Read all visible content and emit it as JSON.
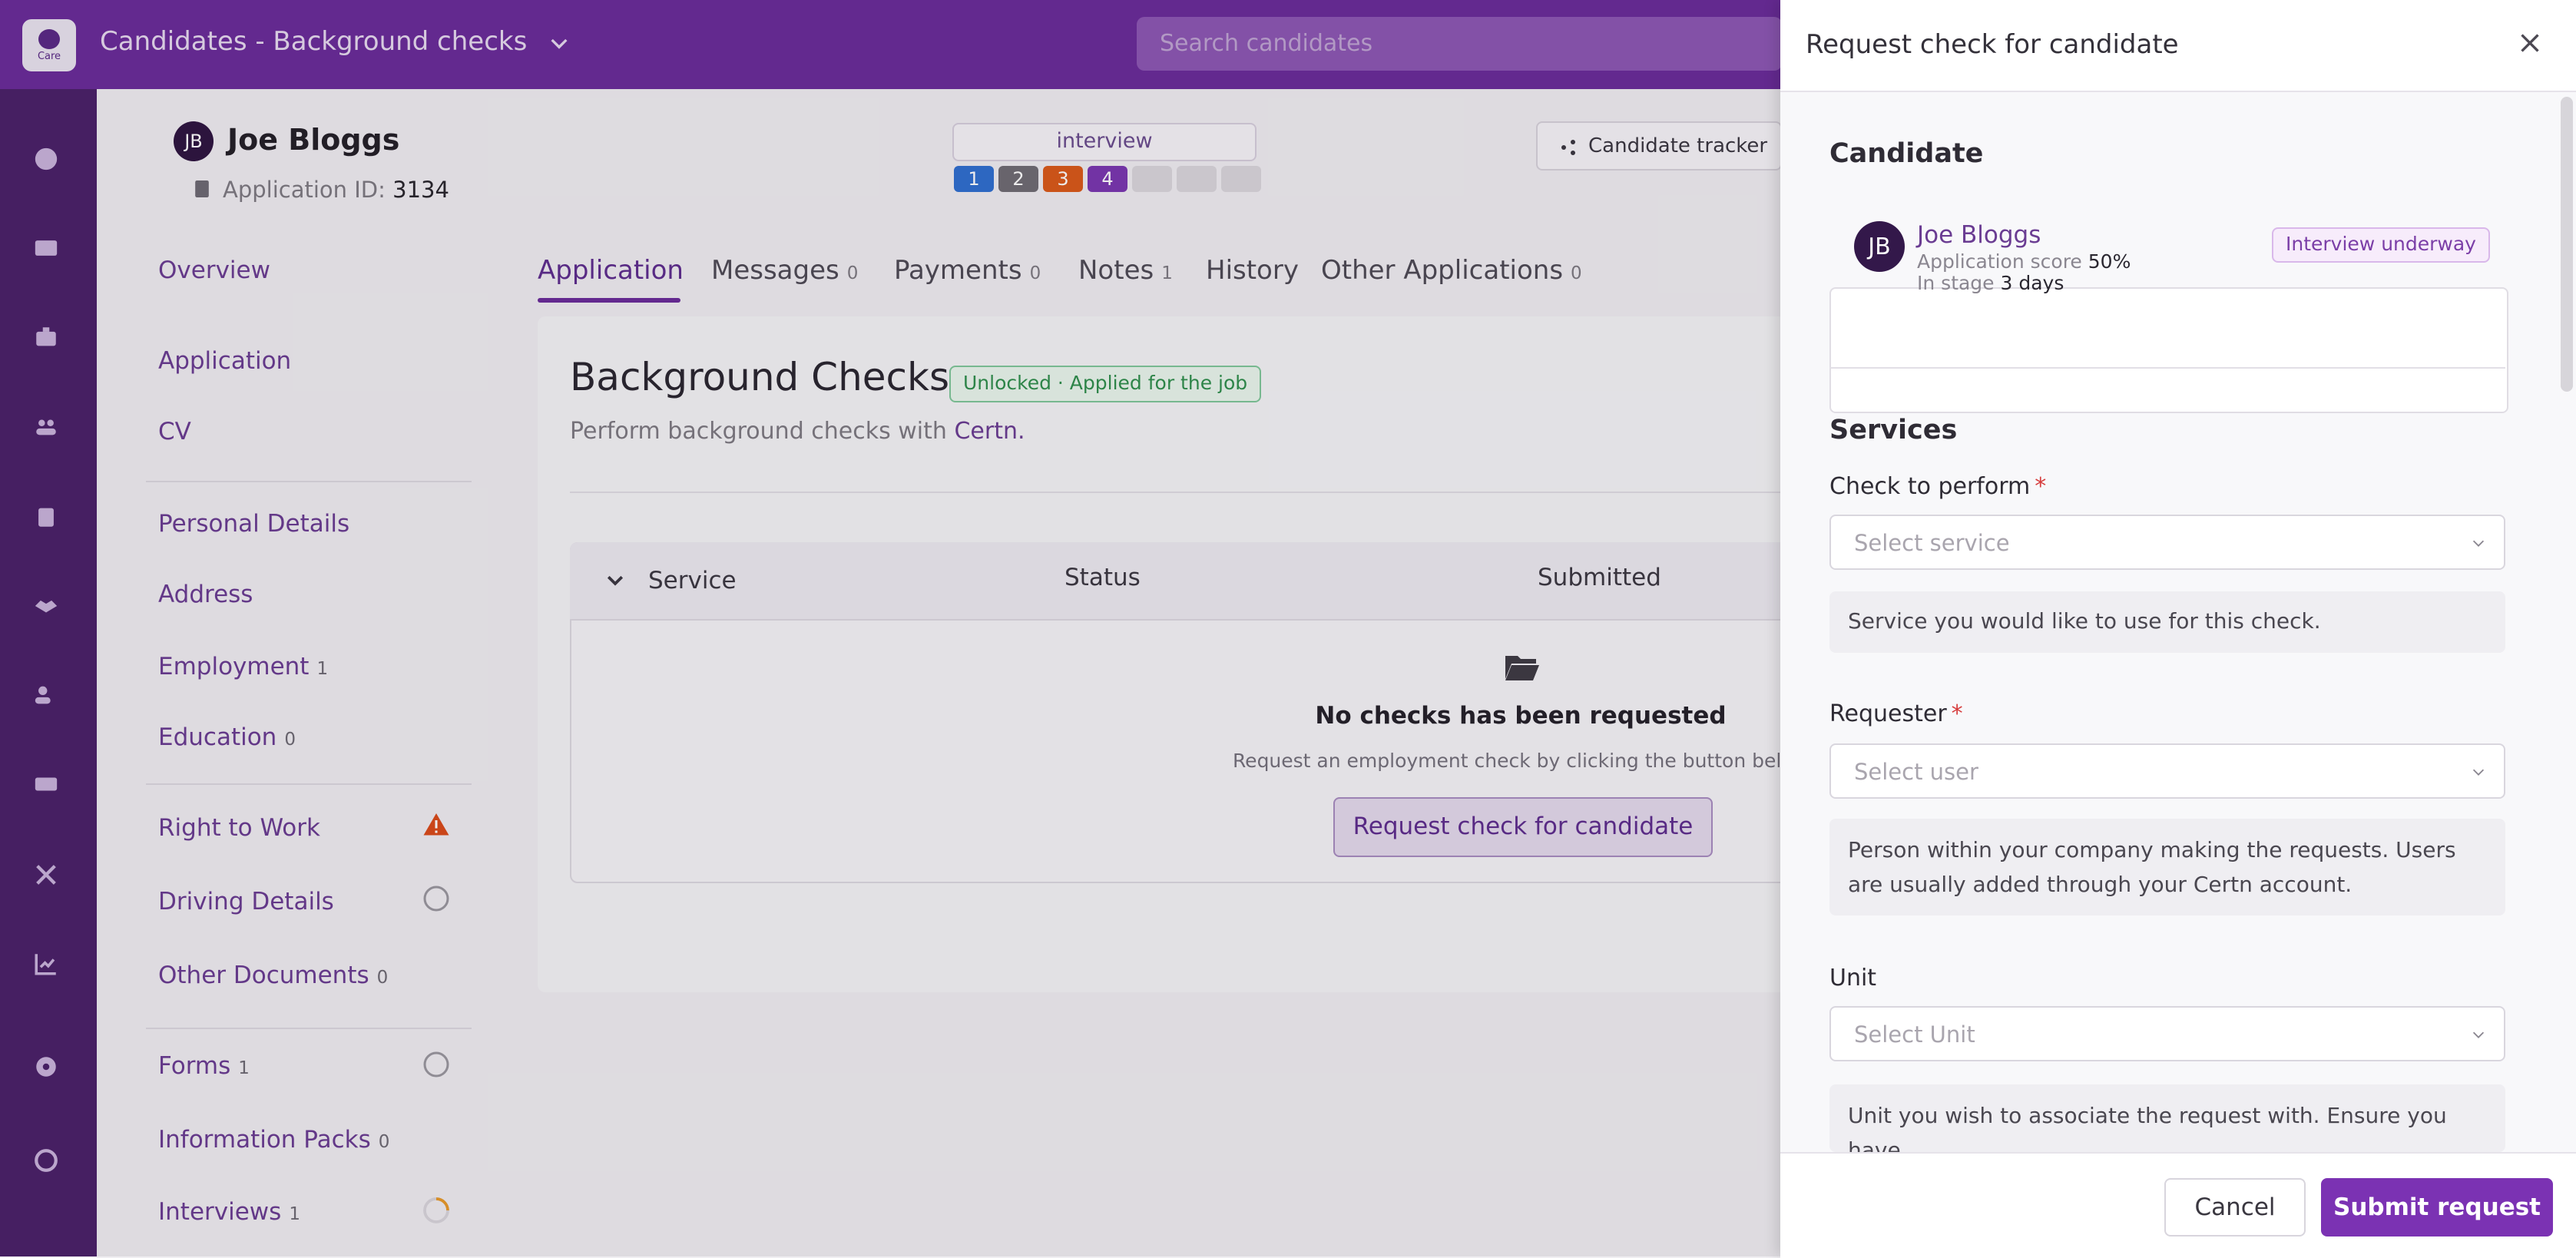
{
  "header": {
    "app_title": "Candidates - Background checks",
    "search_placeholder": "Search candidates",
    "logo_text": "Care"
  },
  "profile": {
    "initials": "JB",
    "name": "Joe Bloggs",
    "application_id_label": "Application ID:",
    "application_id": "3134",
    "stage": "interview",
    "steps": [
      {
        "label": "1",
        "color": "#2f6fd0"
      },
      {
        "label": "2",
        "color": "#6f6c73"
      },
      {
        "label": "3",
        "color": "#d9591a"
      },
      {
        "label": "4",
        "color": "#7a37b0"
      },
      {
        "label": "",
        "color": "#d9d6dc"
      },
      {
        "label": "",
        "color": "#d9d6dc"
      },
      {
        "label": "",
        "color": "#d9d6dc"
      }
    ],
    "tracker_button": "Candidate tracker"
  },
  "sidenav": {
    "overview": "Overview",
    "application": "Application",
    "cv": "CV",
    "personal_details": "Personal Details",
    "address": "Address",
    "employment": "Employment",
    "employment_count": "1",
    "education": "Education",
    "education_count": "0",
    "right_to_work": "Right to Work",
    "driving_details": "Driving Details",
    "other_documents": "Other Documents",
    "other_documents_count": "0",
    "forms": "Forms",
    "forms_count": "1",
    "information_packs": "Information Packs",
    "information_packs_count": "0",
    "interviews": "Interviews",
    "interviews_count": "1"
  },
  "tabs": [
    {
      "label": "Application",
      "count": ""
    },
    {
      "label": "Messages",
      "count": "0"
    },
    {
      "label": "Payments",
      "count": "0"
    },
    {
      "label": "Notes",
      "count": "1"
    },
    {
      "label": "History",
      "count": ""
    },
    {
      "label": "Other Applications",
      "count": "0"
    }
  ],
  "background_checks": {
    "title": "Background Checks",
    "badge": "Unlocked · Applied for the job",
    "subtitle": "Perform background checks with",
    "provider": "Certn.",
    "columns": [
      "Service",
      "Status",
      "Submitted"
    ],
    "empty_title": "No checks has been requested",
    "empty_subtitle": "Request an employment check by clicking the button below",
    "request_button": "Request check for candidate"
  },
  "drawer": {
    "title": "Request check for candidate",
    "candidate_section": "Candidate",
    "candidate": {
      "initials": "JB",
      "name": "Joe Bloggs",
      "score_label": "Application score",
      "score_value": "50%",
      "stage_label": "In stage",
      "stage_value": "3 days",
      "status_badge": "Interview underway"
    },
    "services_section": "Services",
    "check_label": "Check to perform",
    "check_placeholder": "Select service",
    "check_help": "Service you would like to use for this check.",
    "requester_label": "Requester",
    "requester_placeholder": "Select user",
    "requester_help": "Person within your company making the requests. Users are usually added through your Certn account.",
    "unit_label": "Unit",
    "unit_placeholder": "Select Unit",
    "unit_help": "Unit you wish to associate the request with. Ensure you have",
    "required_mark": "*",
    "cancel": "Cancel",
    "submit": "Submit request"
  },
  "colors": {
    "brand": "#6a2c99",
    "primary_button": "#7b32b3",
    "warning": "#d94a1a"
  }
}
